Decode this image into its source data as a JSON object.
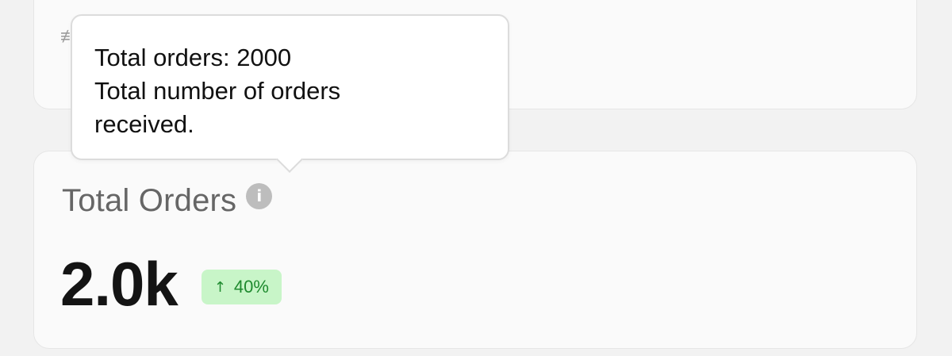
{
  "top_card": {
    "partial_glyph": "≢"
  },
  "orders_card": {
    "title": "Total Orders",
    "info_icon": "i",
    "value": "2.0k",
    "change": {
      "arrow": "↑",
      "percent": "40%",
      "direction": "up",
      "color": "#1e8a2e",
      "background": "#c8f5c8"
    }
  },
  "tooltip": {
    "line1": "Total orders: 2000",
    "line2": "Total number of orders",
    "line3": "received."
  }
}
